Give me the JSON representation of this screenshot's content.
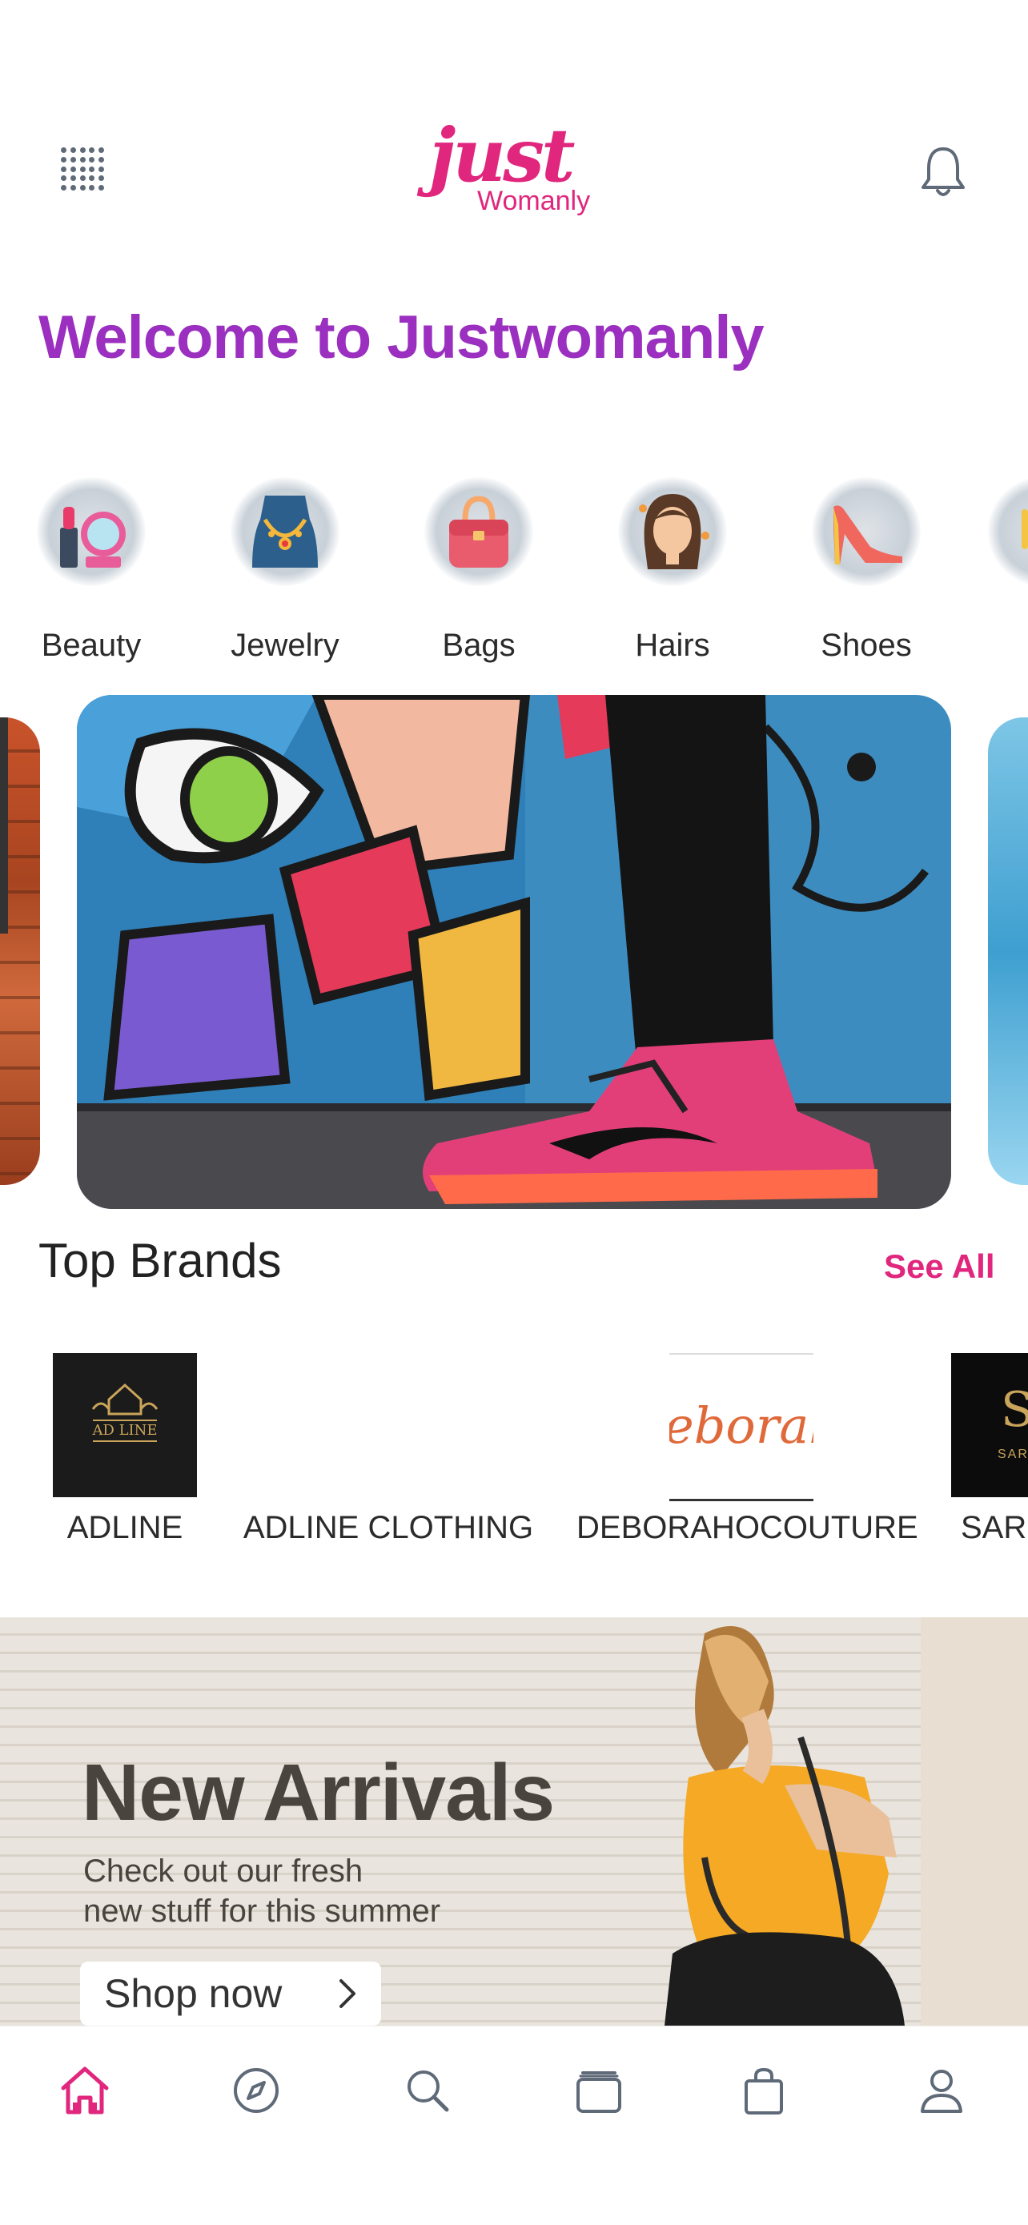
{
  "header": {
    "logo_script": "just",
    "logo_sub": "Womanly",
    "welcome": "Welcome to Justwomanly"
  },
  "categories": [
    {
      "label": "Beauty",
      "icon": "lipstick-mirror-icon"
    },
    {
      "label": "Jewelry",
      "icon": "necklace-icon"
    },
    {
      "label": "Bags",
      "icon": "handbag-icon"
    },
    {
      "label": "Hairs",
      "icon": "hair-icon"
    },
    {
      "label": "Shoes",
      "icon": "high-heel-icon"
    }
  ],
  "top_brands": {
    "title": "Top Brands",
    "see_all": "See All",
    "brands": [
      {
        "name": "ADLINE",
        "logo_text": "AD LINE"
      },
      {
        "name": "ADLINE CLOTHING",
        "logo_text": ""
      },
      {
        "name": "DEBORAHOCOUTURE",
        "logo_text": "eborah"
      },
      {
        "name": "SARI",
        "logo_text": "SARI"
      }
    ]
  },
  "banner": {
    "title": "New Arrivals",
    "subtitle_line1": "Check out our fresh",
    "subtitle_line2": "new stuff for this summer",
    "cta": "Shop now"
  },
  "bottom_nav": [
    {
      "icon": "home-icon",
      "active": true
    },
    {
      "icon": "compass-icon",
      "active": false
    },
    {
      "icon": "search-icon",
      "active": false
    },
    {
      "icon": "collections-icon",
      "active": false
    },
    {
      "icon": "shopping-bag-icon",
      "active": false
    },
    {
      "icon": "profile-icon",
      "active": false
    }
  ],
  "colors": {
    "brand_pink": "#e0267d",
    "welcome_purple": "#9b2fbf",
    "icon_gray": "#5f6a78"
  }
}
